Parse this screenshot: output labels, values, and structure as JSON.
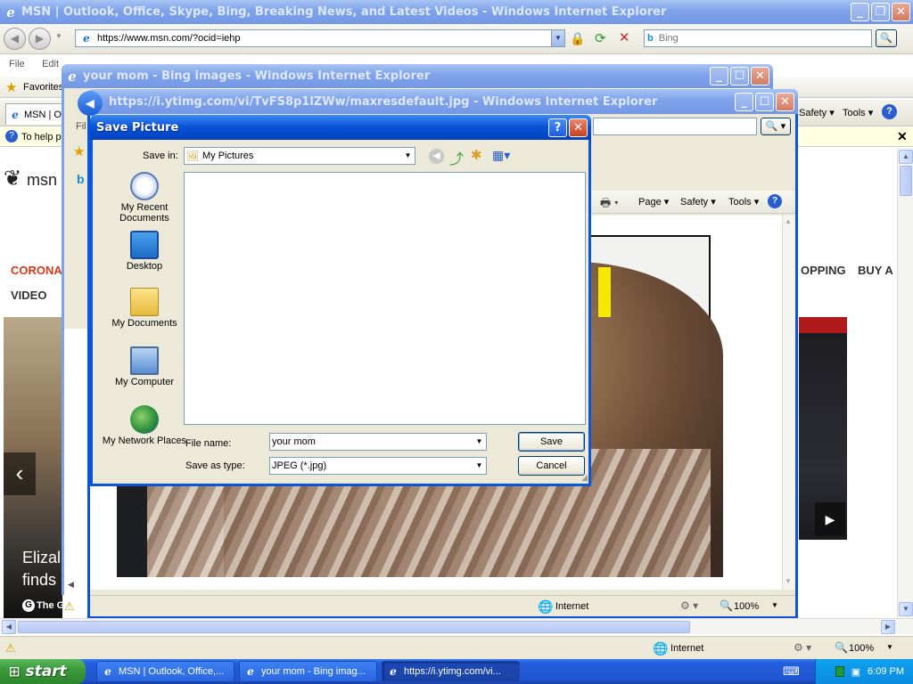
{
  "w1": {
    "title": "MSN | Outlook, Office, Skype, Bing, Breaking News, and Latest Videos - Windows Internet Explorer",
    "address": "https://www.msn.com/?ocid=iehp",
    "search_placeholder": "Bing",
    "menu": [
      "File",
      "Edit"
    ],
    "favorites": "Favorites",
    "tab_label": "MSN | O",
    "infobar": "To help p",
    "cmd_safety": "Safety",
    "cmd_tools": "Tools",
    "msn_logo": "msn",
    "nav_corona": "CORONA",
    "nav_video": "VIDEO",
    "nav_shopping": "OPPING",
    "nav_buy": "BUY A",
    "story_headline_1": "Elizal",
    "story_headline_2": "finds",
    "story_source": "The Guardi",
    "status_zone": "Internet",
    "zoom": "100%"
  },
  "w2": {
    "title": "your mom - Bing images - Windows Internet Explorer"
  },
  "w3": {
    "title": "https://i.ytimg.com/vi/TvFS8p1lZWw/maxresdefault.jpg - Windows Internet Explorer",
    "file_menu": "Fil",
    "cmd_page": "Page",
    "cmd_safety": "Safety",
    "cmd_tools": "Tools",
    "status_zone": "Internet",
    "zoom": "100%"
  },
  "dialog": {
    "title": "Save Picture",
    "save_in_label": "Save in:",
    "save_in_value": "My Pictures",
    "places": [
      "My Recent Documents",
      "Desktop",
      "My Documents",
      "My Computer",
      "My Network Places"
    ],
    "file_name_label": "File name:",
    "file_name_value": "your mom",
    "save_type_label": "Save as type:",
    "save_type_value": "JPEG (*.jpg)",
    "save_button": "Save",
    "cancel_button": "Cancel"
  },
  "taskbar": {
    "start": "start",
    "items": [
      "MSN | Outlook, Office,...",
      "your mom - Bing imag...",
      "https://i.ytimg.com/vi..."
    ],
    "clock": "6:09 PM"
  },
  "colors": {
    "xp_blue": "#0a55d8",
    "msn_red": "#d23b1a",
    "start_green": "#3c9a3c"
  }
}
